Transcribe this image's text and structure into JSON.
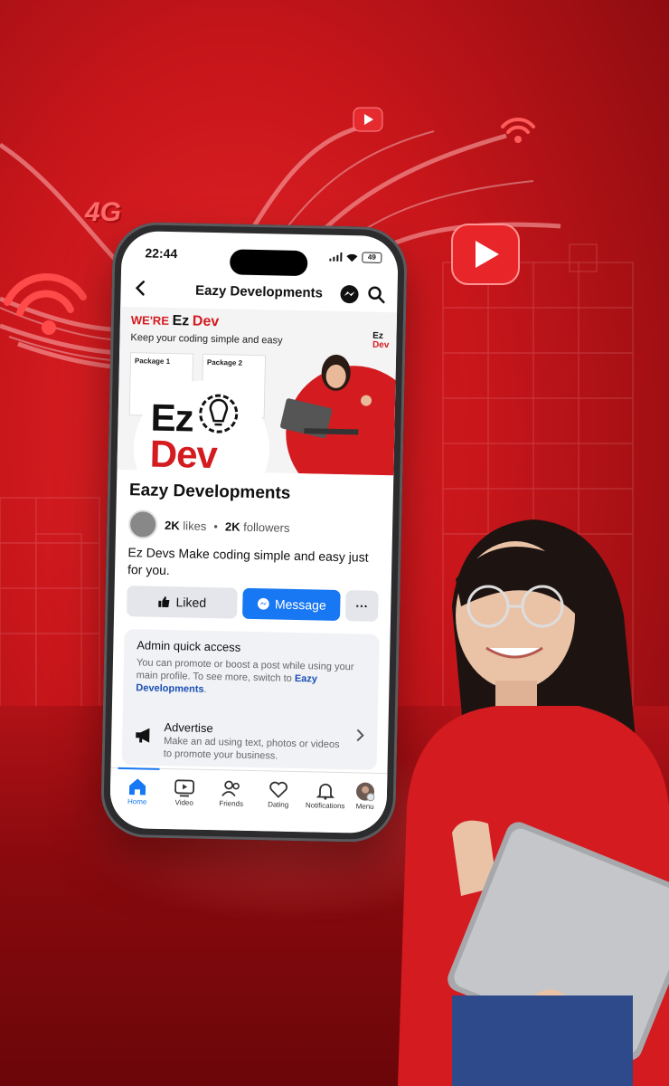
{
  "status_bar": {
    "time": "22:44",
    "battery": "49"
  },
  "nav": {
    "title": "Eazy Developments"
  },
  "cover": {
    "tag_prefix": "WE'RE",
    "tag_ez": "Ez",
    "tag_dev": "Dev",
    "subtitle": "Keep your coding simple and easy",
    "mini_logo_top": "Ez",
    "mini_logo_bottom": "Dev",
    "package1": "Package 1",
    "package2": "Package 2",
    "logo_ez": "Ez",
    "logo_dev": "Dev"
  },
  "page": {
    "name": "Eazy Developments",
    "likes_count": "2K",
    "likes_label": "likes",
    "separator": "•",
    "followers_count": "2K",
    "followers_label": "followers",
    "description": "Ez Devs Make coding simple and easy just for you."
  },
  "actions": {
    "liked_label": "Liked",
    "message_label": "Message",
    "more_label": "···"
  },
  "quick_access": {
    "title": "Admin quick access",
    "desc_prefix": "You can promote or boost a post while using your main profile. To see more, switch to ",
    "desc_link": "Eazy Developments",
    "desc_suffix": ".",
    "advertise_title": "Advertise",
    "advertise_desc": "Make an ad using text, photos or videos to promote your business."
  },
  "tabs": [
    {
      "label": "Home",
      "icon": "home-icon",
      "active": true
    },
    {
      "label": "Video",
      "icon": "video-icon"
    },
    {
      "label": "Friends",
      "icon": "friends-icon"
    },
    {
      "label": "Dating",
      "icon": "dating-icon"
    },
    {
      "label": "Notifications",
      "icon": "bell-icon"
    },
    {
      "label": "Menu",
      "icon": "menu-avatar-icon"
    }
  ],
  "decor": {
    "badge_4g": "4G"
  },
  "colors": {
    "brand_red": "#d31b20",
    "facebook_blue": "#1877f2",
    "background_red": "#c8161b"
  }
}
